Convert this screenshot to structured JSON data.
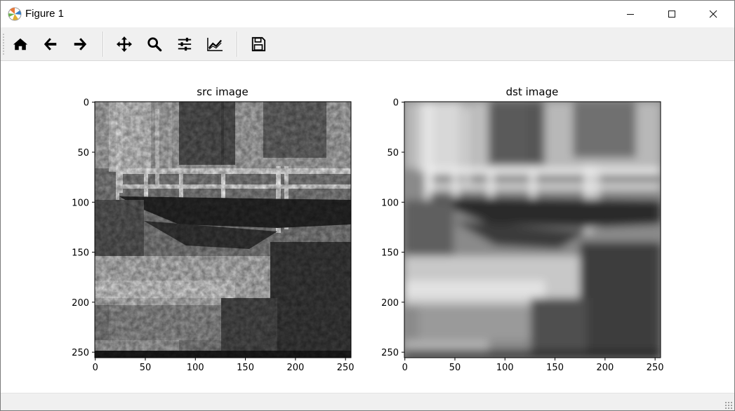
{
  "window": {
    "title": "Figure 1"
  },
  "toolbar": {
    "home": "home-icon",
    "back": "back-arrow-icon",
    "forward": "forward-arrow-icon",
    "pan": "pan-icon",
    "zoom": "zoom-icon",
    "subplots": "configure-subplots-icon",
    "customize": "customize-icon",
    "save": "save-icon"
  },
  "chart_data": [
    {
      "type": "image",
      "title": "src image",
      "xlim": [
        0,
        255
      ],
      "ylim": [
        255,
        0
      ],
      "x_ticks": [
        "0",
        "50",
        "100",
        "150",
        "200",
        "250"
      ],
      "y_ticks": [
        "0",
        "50",
        "100",
        "150",
        "200",
        "250"
      ],
      "colormap": "gray"
    },
    {
      "type": "image",
      "title": "dst image",
      "xlim": [
        0,
        255
      ],
      "ylim": [
        255,
        0
      ],
      "x_ticks": [
        "0",
        "50",
        "100",
        "150",
        "200",
        "250"
      ],
      "y_ticks": [
        "0",
        "50",
        "100",
        "150",
        "200",
        "250"
      ],
      "colormap": "gray"
    }
  ]
}
